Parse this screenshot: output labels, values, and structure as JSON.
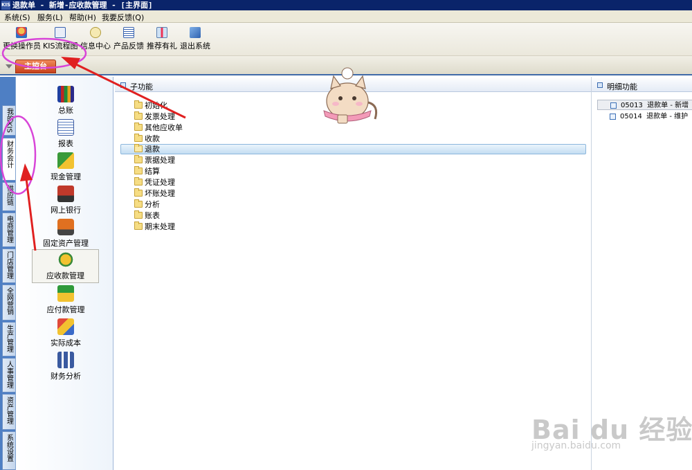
{
  "window": {
    "title": "退款单 - 新增-应收款管理 - [主界面]",
    "app_icon": "KIS"
  },
  "menubar": {
    "items": [
      "系统(S)",
      "服务(L)",
      "帮助(H)",
      "我要反馈(Q)"
    ]
  },
  "toolbar": {
    "buttons": [
      {
        "label": "更换操作员",
        "icon": "switch-user-icon"
      },
      {
        "label": "KIS流程图",
        "icon": "flowchart-icon"
      },
      {
        "label": "信息中心",
        "icon": "message-icon"
      },
      {
        "label": "产品反馈",
        "icon": "feedback-icon"
      },
      {
        "label": "推荐有礼",
        "icon": "gift-icon"
      },
      {
        "label": "退出系统",
        "icon": "exit-icon"
      }
    ]
  },
  "tabbar": {
    "main_tab": "主控台"
  },
  "vertical_tabs": [
    "我的KIS",
    "财务会计",
    "供应链",
    "电商管理",
    "门店管理",
    "全网营销",
    "生产管理",
    "人事管理",
    "资产管理",
    "系统设置"
  ],
  "modules": [
    {
      "label": "总账",
      "icon": "ledger-books-icon"
    },
    {
      "label": "报表",
      "icon": "report-icon"
    },
    {
      "label": "现金管理",
      "icon": "cash-icon"
    },
    {
      "label": "网上银行",
      "icon": "online-bank-icon"
    },
    {
      "label": "固定资产管理",
      "icon": "fixed-asset-truck-icon"
    },
    {
      "label": "应收款管理",
      "icon": "money-bag-icon"
    },
    {
      "label": "应付款管理",
      "icon": "payment-icon"
    },
    {
      "label": "实际成本",
      "icon": "cost-cubes-icon"
    },
    {
      "label": "财务分析",
      "icon": "analysis-icon"
    }
  ],
  "subfunctions": {
    "header": "子功能",
    "items": [
      "初始化",
      "发票处理",
      "其他应收单",
      "收款",
      "退款",
      "票据处理",
      "结算",
      "凭证处理",
      "坏账处理",
      "分析",
      "账表",
      "期末处理"
    ],
    "selected": "退款"
  },
  "details": {
    "header": "明细功能",
    "items": [
      {
        "code": "05013",
        "name": "退款单 - 新增"
      },
      {
        "code": "05014",
        "name": "退款单 - 维护"
      }
    ]
  },
  "watermark": {
    "logo": "Bai du 经验",
    "url": "jingyan.baidu.com"
  },
  "colors": {
    "title_bar": "#0a246a",
    "tab_accent": "#d9582b",
    "vtab_strip": "#4e7fc4",
    "selection": "#c3ddf2",
    "annotation": "#e02020",
    "circle": "#d845d8"
  }
}
